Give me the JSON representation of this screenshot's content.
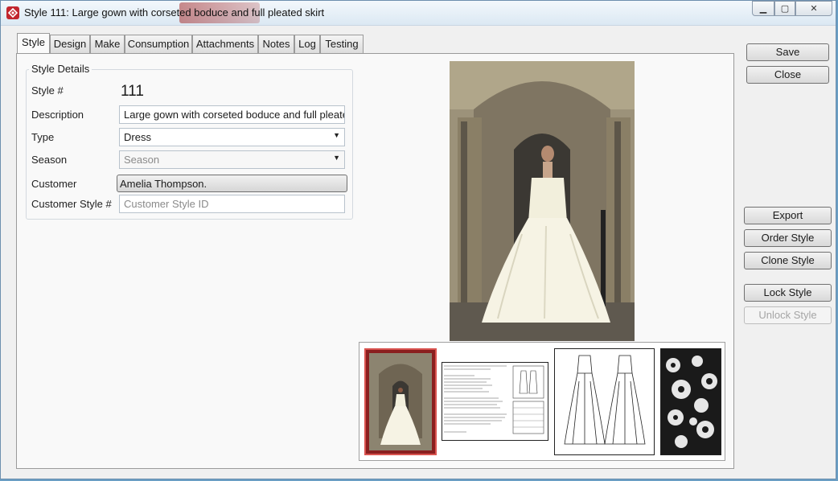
{
  "window": {
    "title": "Style 111: Large gown with corseted boduce and full pleated skirt",
    "minimize_glyph": "▁",
    "maximize_glyph": "▢",
    "close_glyph": "✕"
  },
  "tabs": [
    {
      "label": "Style",
      "active": true
    },
    {
      "label": "Design"
    },
    {
      "label": "Make"
    },
    {
      "label": "Consumption"
    },
    {
      "label": "Attachments"
    },
    {
      "label": "Notes"
    },
    {
      "label": "Log"
    },
    {
      "label": "Testing"
    }
  ],
  "style_details": {
    "group_title": "Style Details",
    "style_no_label": "Style #",
    "style_no_value": "111",
    "description_label": "Description",
    "description_value": "Large gown with corseted boduce and full pleated s",
    "type_label": "Type",
    "type_value": "Dress",
    "season_label": "Season",
    "season_placeholder": "Season",
    "customer_label": "Customer",
    "customer_value": "Amelia Thompson.",
    "customer_style_label": "Customer Style #",
    "customer_style_placeholder": "Customer Style ID"
  },
  "buttons": {
    "save": "Save",
    "close": "Close",
    "export": "Export",
    "order_style": "Order Style",
    "clone_style": "Clone Style",
    "lock_style": "Lock Style",
    "unlock_style": "Unlock Style"
  },
  "attachments": [
    {
      "kind": "photo",
      "selected": true
    },
    {
      "kind": "spec-sheet"
    },
    {
      "kind": "technical-drawing"
    },
    {
      "kind": "lace-fabric"
    }
  ],
  "colors": {
    "accent_red": "#c2262e",
    "selected_thumb": "#d9534f"
  }
}
